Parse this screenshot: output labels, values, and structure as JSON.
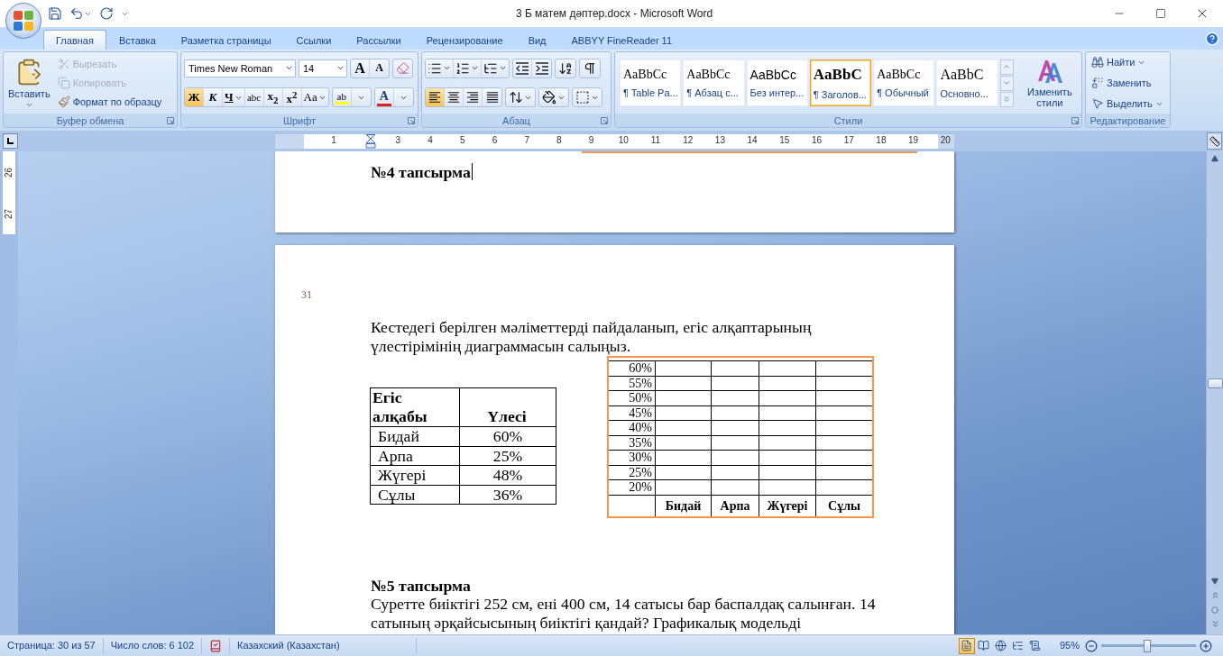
{
  "window": {
    "title": "3 Б матем дәптер.docx - Microsoft Word"
  },
  "tabs": [
    {
      "label": "Главная",
      "selected": true
    },
    {
      "label": "Вставка",
      "selected": false
    },
    {
      "label": "Разметка страницы",
      "selected": false
    },
    {
      "label": "Ссылки",
      "selected": false
    },
    {
      "label": "Рассылки",
      "selected": false
    },
    {
      "label": "Рецензирование",
      "selected": false
    },
    {
      "label": "Вид",
      "selected": false
    },
    {
      "label": "ABBYY FineReader 11",
      "selected": false
    }
  ],
  "ribbon": {
    "clipboard": {
      "title": "Буфер обмена",
      "paste": "Вставить",
      "items": [
        {
          "label": "Вырезать",
          "kind": "cut",
          "disabled": true
        },
        {
          "label": "Копировать",
          "kind": "copy",
          "disabled": true
        },
        {
          "label": "Формат по образцу",
          "kind": "painter",
          "disabled": false
        }
      ]
    },
    "font": {
      "title": "Шрифт",
      "font_name": "Times New Roman",
      "font_size": "14",
      "size_buttons": [
        {
          "label": "A",
          "kind": "grow"
        },
        {
          "label": "A",
          "kind": "shrink"
        }
      ],
      "format_buttons": [
        {
          "label": "Ж",
          "kind": "bold",
          "selected": true
        },
        {
          "label": "К",
          "kind": "italic",
          "selected": false
        },
        {
          "label": "Ч",
          "kind": "underline",
          "selected": false
        },
        {
          "label": "abc",
          "kind": "strike",
          "selected": false
        },
        {
          "label": "x$_{2}$",
          "kind": "sub",
          "selected": false
        },
        {
          "label": "x$^{2}$",
          "kind": "sup",
          "selected": false
        },
        {
          "label": "Aa",
          "kind": "case",
          "selected": false
        }
      ],
      "highlight": "ab",
      "font_color": "A"
    },
    "paragraph": {
      "title": "Абзац",
      "tools": [
        {
          "kind": "bullets"
        },
        {
          "kind": "numbering"
        },
        {
          "kind": "multilevel"
        },
        {
          "kind": "outdent"
        },
        {
          "kind": "indent"
        },
        {
          "kind": "sort"
        },
        {
          "kind": "pilcrow"
        }
      ],
      "align": [
        {
          "kind": "left",
          "selected": true
        },
        {
          "kind": "center",
          "selected": false
        },
        {
          "kind": "right",
          "selected": false
        },
        {
          "kind": "justify",
          "selected": false
        }
      ],
      "extras": [
        {
          "kind": "spacing"
        },
        {
          "kind": "shading"
        },
        {
          "kind": "borders"
        }
      ]
    },
    "styles": {
      "title": "Стили",
      "items": [
        {
          "preview": "AaBbCc",
          "label": "¶ Table Pa...",
          "kind": "serif",
          "selected": false
        },
        {
          "preview": "AaBbCc",
          "label": "¶ Абзац с...",
          "kind": "serif",
          "selected": false
        },
        {
          "preview": "AaBbCc",
          "label": "Без интер...",
          "kind": "sans",
          "selected": false
        },
        {
          "preview": "AaBbC",
          "label": "¶ Заголов...",
          "kind": "heading",
          "selected": true
        },
        {
          "preview": "AaBbCc",
          "label": "¶ Обычный",
          "kind": "serif",
          "selected": false
        },
        {
          "preview": "AaBbC",
          "label": "Основно...",
          "kind": "large",
          "selected": false
        }
      ],
      "change": "Изменить стили"
    },
    "editing": {
      "title": "Редактирование",
      "items": [
        {
          "label": "Найти",
          "kind": "find"
        },
        {
          "label": "Заменить",
          "kind": "replace"
        },
        {
          "label": "Выделить",
          "kind": "select"
        }
      ]
    }
  },
  "ruler": {
    "labels": [
      "1",
      "3",
      "4",
      "5",
      "6",
      "7",
      "8",
      "9",
      "10",
      "11",
      "12",
      "13",
      "14",
      "15",
      "16",
      "17",
      "18",
      "19",
      "20"
    ]
  },
  "vertical_ruler": {
    "labels": [
      "26",
      "27"
    ]
  },
  "document": {
    "page_top": {
      "heading": "№4 тапсырма"
    },
    "page": {
      "page_number": "31",
      "intro": "Кестедегі берілген мәліметтерді пайдаланып, егіс алқаптарының үлестірімінің диаграммасын салыңыз.",
      "table": {
        "columns": [
          "Егіс алқабы",
          "Үлесі"
        ],
        "rows": [
          [
            "Бидай",
            "60%"
          ],
          [
            "Арпа",
            "25%"
          ],
          [
            "Жүгері",
            "48%"
          ],
          [
            "Сұлы",
            "36%"
          ]
        ]
      },
      "grid": {
        "selected": true,
        "y_labels": [
          "60%",
          "55%",
          "50%",
          "45%",
          "40%",
          "35%",
          "30%",
          "25%",
          "20%"
        ],
        "columns": [
          "Бидай",
          "Арпа",
          "Жүгері",
          "Сұлы"
        ]
      },
      "task": {
        "heading": "№5 тапсырма",
        "text": "Суретте биіктігі 252 см, ені 400 см, 14 сатысы бар баспалдақ салынған. 14 сатының әрқайсысының биіктігі қандай? Графикалық модельді"
      }
    }
  },
  "status_bar": {
    "page": "Страница: 30 из 57",
    "words": "Число слов: 6 102",
    "language": "Казахский (Казахстан)",
    "views": [
      {
        "kind": "print",
        "selected": true
      },
      {
        "kind": "reading",
        "selected": false
      },
      {
        "kind": "web",
        "selected": false
      },
      {
        "kind": "outline",
        "selected": false
      },
      {
        "kind": "draft",
        "selected": false
      }
    ],
    "zoom": {
      "reading": "95%",
      "level": 0.48
    }
  }
}
